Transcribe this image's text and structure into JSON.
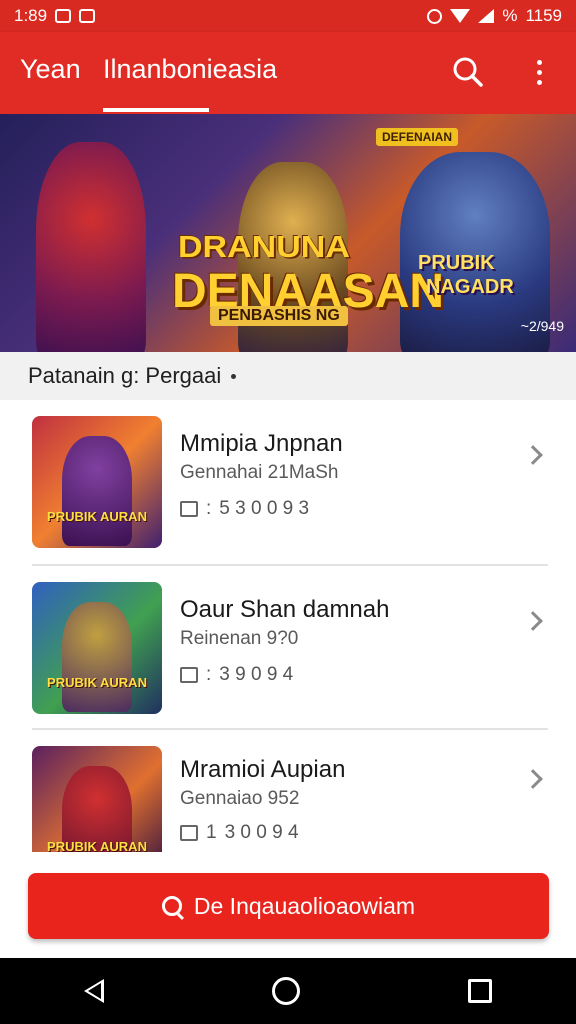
{
  "status_bar": {
    "time": "1:89",
    "battery_text": "1159",
    "signal_text": "%"
  },
  "app_bar": {
    "tabs": [
      {
        "label": "Yean"
      },
      {
        "label": "Ilnanbonieasia"
      }
    ],
    "active_tab_index": 1,
    "icons": [
      "search-icon",
      "more-vert-icon"
    ]
  },
  "banner": {
    "badge": "DEFENAIAN",
    "logo_line_1": "DRANUNA",
    "logo_line_2": "DENAASAN",
    "tagline": "PENBASHIS NG",
    "sub_line_1": "PRUBIK",
    "sub_line_2": "NAGADR",
    "count": "~2/949"
  },
  "section": {
    "title": "Patanain g: Pergaai"
  },
  "items": [
    {
      "title": "Mmipia Jnpnan",
      "subtitle": "Gennahai 21MaSh",
      "meta": "5 3 0 0 9 3",
      "meta_prefix": ":",
      "thumb_label": "PRUBIK AURAN"
    },
    {
      "title": "Oaur Shan damnah",
      "subtitle": "Reinenan 9?0",
      "meta": "3 9 0 9 4",
      "meta_prefix": ":",
      "thumb_label": "PRUBIK AURAN"
    },
    {
      "title": "Mramioi Aupian",
      "subtitle": "Gennaiao 952",
      "meta": "3 0 0 9 4",
      "meta_prefix": "1",
      "thumb_label": "PRUBIK AURAN"
    }
  ],
  "cta": {
    "label": "De Inqauaolioaowiam",
    "icon": "search-icon"
  },
  "colors": {
    "primary": "#e02c24",
    "status_bar": "#d92a22",
    "cta": "#e8241d"
  }
}
